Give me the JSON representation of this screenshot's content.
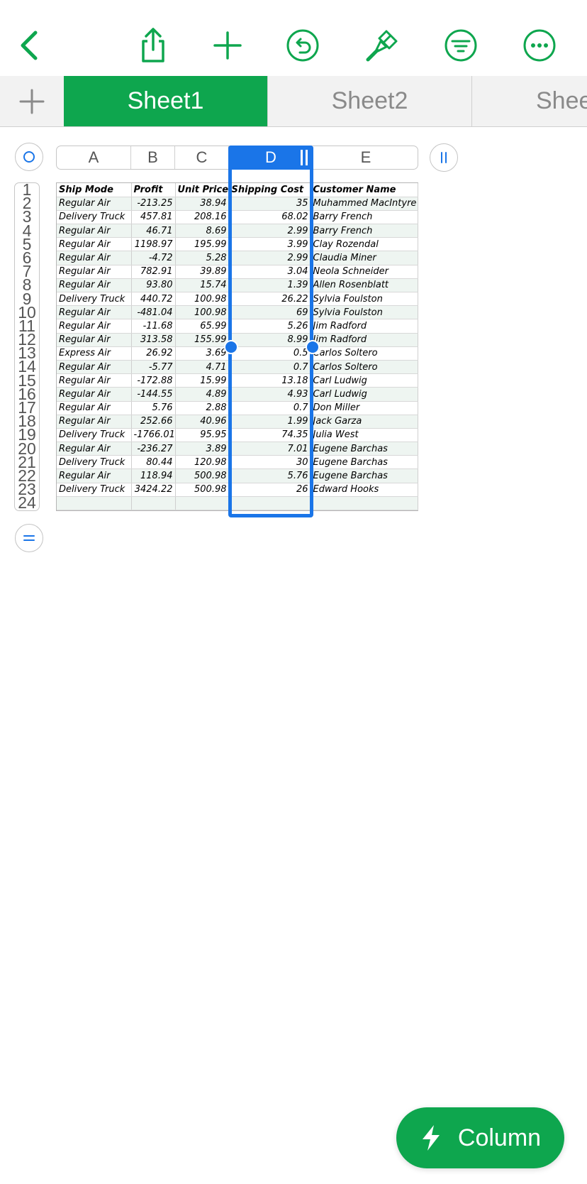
{
  "colors": {
    "accent": "#0ea64e",
    "selection": "#1a75e8"
  },
  "toolbar": {
    "icons": [
      "back-icon",
      "share-icon",
      "add-icon",
      "undo-icon",
      "format-brush-icon",
      "filter-icon",
      "more-icon"
    ]
  },
  "tabs": [
    {
      "label": "Sheet1",
      "active": true
    },
    {
      "label": "Sheet2",
      "active": false
    },
    {
      "label": "Shee",
      "active": false
    }
  ],
  "columns": [
    "A",
    "B",
    "C",
    "D",
    "E"
  ],
  "selected_column": "D",
  "rows": [
    "1",
    "2",
    "3",
    "4",
    "5",
    "6",
    "7",
    "8",
    "9",
    "10",
    "11",
    "12",
    "13",
    "14",
    "15",
    "16",
    "17",
    "18",
    "19",
    "20",
    "21",
    "22",
    "23",
    "24"
  ],
  "table": {
    "header": [
      "Ship Mode",
      "Profit",
      "Unit Price",
      "Shipping Cost",
      "Customer Name"
    ],
    "data": [
      [
        "Regular Air",
        "-213.25",
        "38.94",
        "35",
        "Muhammed MacIntyre"
      ],
      [
        "Delivery Truck",
        "457.81",
        "208.16",
        "68.02",
        "Barry French"
      ],
      [
        "Regular Air",
        "46.71",
        "8.69",
        "2.99",
        "Barry French"
      ],
      [
        "Regular Air",
        "1198.97",
        "195.99",
        "3.99",
        "Clay Rozendal"
      ],
      [
        "Regular Air",
        "-4.72",
        "5.28",
        "2.99",
        "Claudia Miner"
      ],
      [
        "Regular Air",
        "782.91",
        "39.89",
        "3.04",
        "Neola Schneider"
      ],
      [
        "Regular Air",
        "93.80",
        "15.74",
        "1.39",
        "Allen Rosenblatt"
      ],
      [
        "Delivery Truck",
        "440.72",
        "100.98",
        "26.22",
        "Sylvia Foulston"
      ],
      [
        "Regular Air",
        "-481.04",
        "100.98",
        "69",
        "Sylvia Foulston"
      ],
      [
        "Regular Air",
        "-11.68",
        "65.99",
        "5.26",
        "Jim Radford"
      ],
      [
        "Regular Air",
        "313.58",
        "155.99",
        "8.99",
        "Jim Radford"
      ],
      [
        "Express Air",
        "26.92",
        "3.69",
        "0.5",
        "Carlos Soltero"
      ],
      [
        "Regular Air",
        "-5.77",
        "4.71",
        "0.7",
        "Carlos Soltero"
      ],
      [
        "Regular Air",
        "-172.88",
        "15.99",
        "13.18",
        "Carl Ludwig"
      ],
      [
        "Regular Air",
        "-144.55",
        "4.89",
        "4.93",
        "Carl Ludwig"
      ],
      [
        "Regular Air",
        "5.76",
        "2.88",
        "0.7",
        "Don Miller"
      ],
      [
        "Regular Air",
        "252.66",
        "40.96",
        "1.99",
        "Jack Garza"
      ],
      [
        "Delivery Truck",
        "-1766.01",
        "95.95",
        "74.35",
        "Julia West"
      ],
      [
        "Regular Air",
        "-236.27",
        "3.89",
        "7.01",
        "Eugene Barchas"
      ],
      [
        "Delivery Truck",
        "80.44",
        "120.98",
        "30",
        "Eugene Barchas"
      ],
      [
        "Regular Air",
        "118.94",
        "500.98",
        "5.76",
        "Eugene Barchas"
      ],
      [
        "Delivery Truck",
        "3424.22",
        "500.98",
        "26",
        "Edward Hooks"
      ],
      [
        "",
        "",
        "",
        "",
        ""
      ]
    ]
  },
  "fab": {
    "label": "Column",
    "icon": "lightning-icon"
  }
}
